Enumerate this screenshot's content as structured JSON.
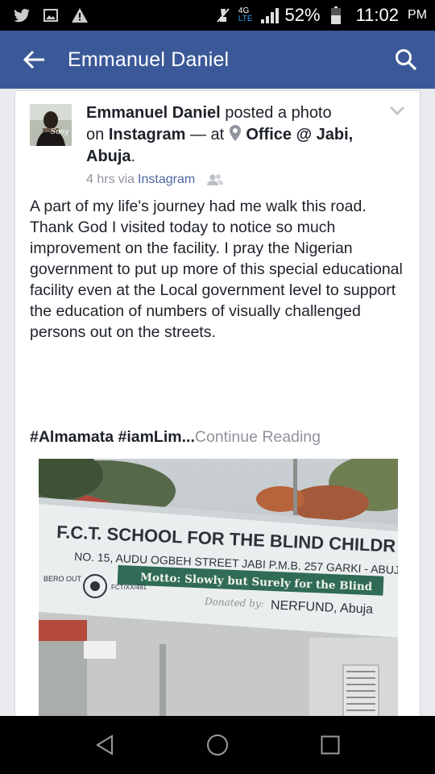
{
  "status_bar": {
    "icons": [
      "twitter-icon",
      "image-icon",
      "warning-icon",
      "mute-icon",
      "signal-icon",
      "battery-icon"
    ],
    "network_top": "4G",
    "network_bottom": "LTE",
    "network_sub": "LTE",
    "battery": "52%",
    "time": "11:02",
    "ampm": "PM"
  },
  "app_bar": {
    "title": "Emmanuel Daniel",
    "color": "#3b5998"
  },
  "post": {
    "author": "Emmanuel Daniel",
    "action": "posted a photo",
    "on_word": "on",
    "platform": "Instagram",
    "at_word": "— at",
    "place_line1": "Office @ Jabi,",
    "place_line2": "Abuja",
    "time": "4 hrs",
    "via_word": "via",
    "via": "Instagram",
    "body": "A part of my life's journey had me walk this road. Thank God I visited today to notice so much improvement on the facility. I pray the Nigerian government to put up more of this special educational facility even at the Local government level to support the education of numbers of visually challenged persons out on the streets.",
    "tag1": "#Almamata",
    "tag2": "#iamLim",
    "ellipsis": "...",
    "continue": "Continue Reading",
    "avatar_caption": "Sony",
    "photo": {
      "sign_title": "F.C.T. SCHOOL FOR THE BLIND CHILDR",
      "sign_address": "NO. 15, AUDU OGBEH STREET JABI P.M.B. 257 GARKI - ABUJ",
      "motto": "Motto: Slowly but Surely for the Blind",
      "donated_by": "Donated by:",
      "donor": "NERFUND, Abuja",
      "left_code": "BERO OUT",
      "left_code2": "FCT/XX/481"
    }
  }
}
